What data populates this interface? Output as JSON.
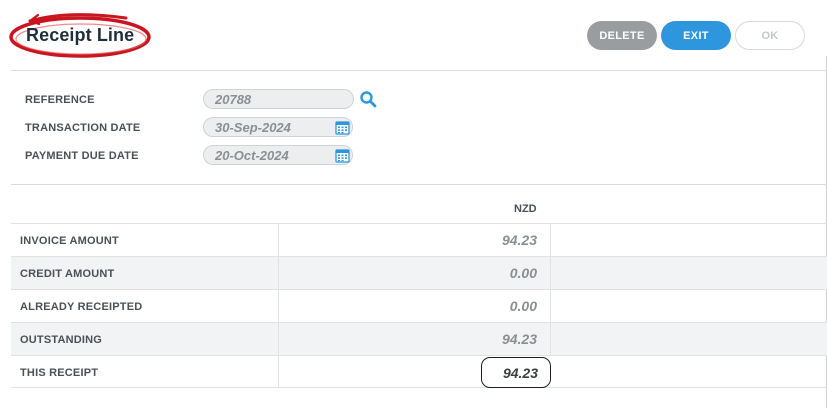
{
  "header": {
    "title": "Receipt Line",
    "buttons": {
      "delete": "DELETE",
      "exit": "EXIT",
      "ok": "OK"
    }
  },
  "form": {
    "reference": {
      "label": "REFERENCE",
      "value": "20788"
    },
    "transaction_date": {
      "label": "TRANSACTION DATE",
      "value": "30-Sep-2024"
    },
    "payment_due_date": {
      "label": "PAYMENT DUE DATE",
      "value": "20-Oct-2024"
    }
  },
  "table": {
    "currency": "NZD",
    "rows": [
      {
        "label": "INVOICE AMOUNT",
        "value": "94.23"
      },
      {
        "label": "CREDIT AMOUNT",
        "value": "0.00"
      },
      {
        "label": "ALREADY RECEIPTED",
        "value": "0.00"
      },
      {
        "label": "OUTSTANDING",
        "value": "94.23"
      },
      {
        "label": "THIS RECEIPT",
        "value": "94.23"
      }
    ]
  },
  "colors": {
    "accent_blue": "#2e96dc",
    "delete_grey": "#9a9d9f",
    "logo_red": "#c8151f"
  },
  "icons": {
    "reference_lookup": "search-icon",
    "date_picker": "calendar-icon"
  }
}
